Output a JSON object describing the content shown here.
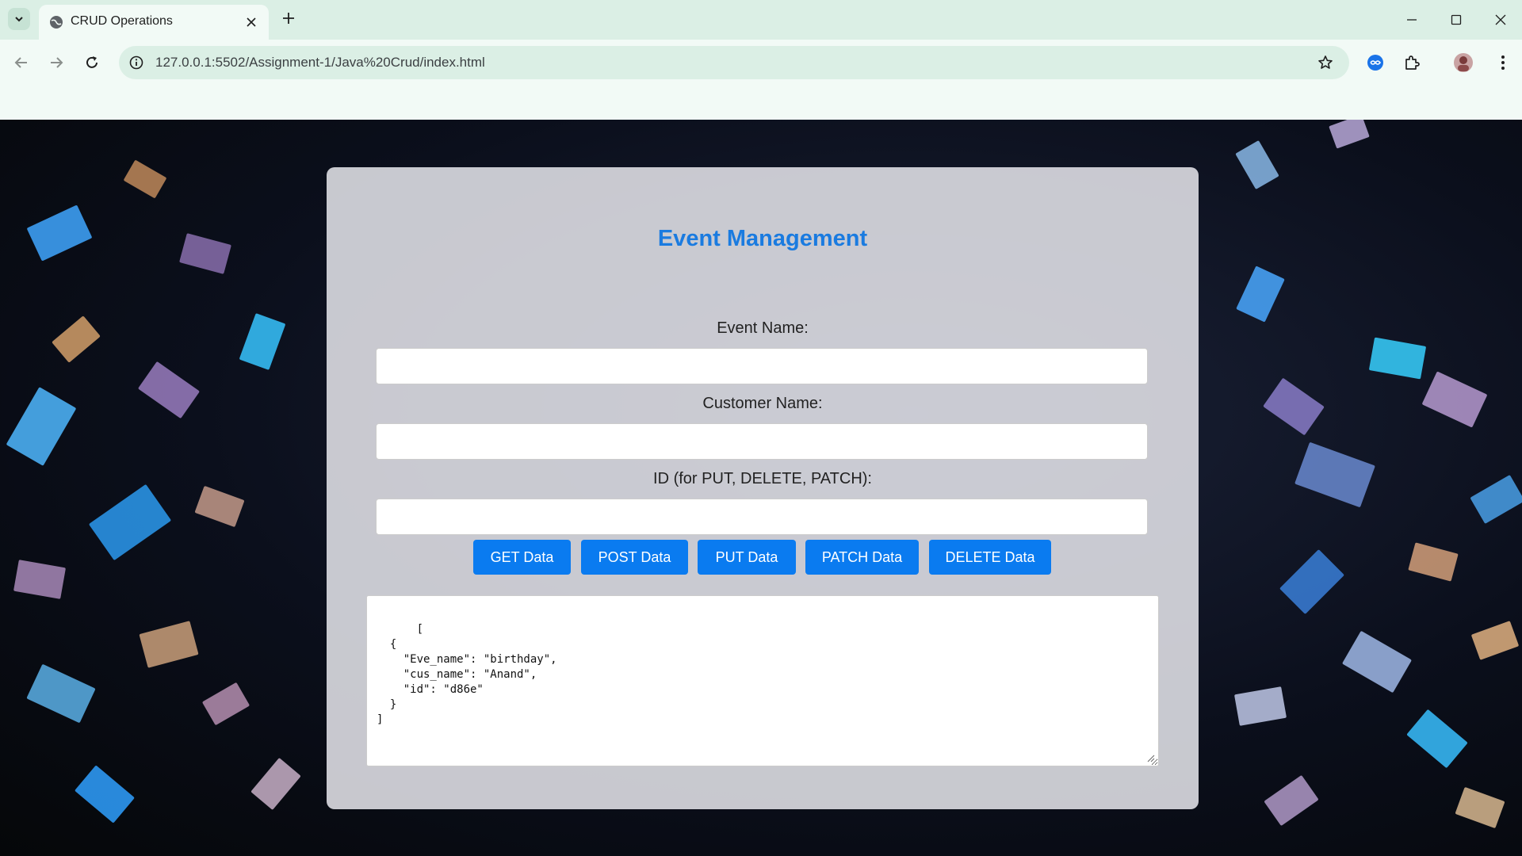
{
  "browser": {
    "tab_title": "CRUD Operations",
    "url": "127.0.0.1:5502/Assignment-1/Java%20Crud/index.html",
    "icons": [
      "tab-search-icon",
      "globe-icon",
      "close-icon",
      "plus-icon",
      "minimize-icon",
      "maximize-icon",
      "window-close-icon",
      "back-icon",
      "forward-icon",
      "reload-icon",
      "info-icon",
      "star-icon",
      "extension-icon",
      "puzzle-icon",
      "avatar",
      "kebab-menu-icon"
    ]
  },
  "page": {
    "title": "Event Management",
    "event_name_label": "Event Name:",
    "event_name_value": "",
    "customer_name_label": "Customer Name:",
    "customer_name_value": "",
    "id_label": "ID (for PUT, DELETE, PATCH):",
    "id_value": "",
    "buttons": {
      "get": "GET Data",
      "post": "POST Data",
      "put": "PUT Data",
      "patch": "PATCH Data",
      "delete": "DELETE Data"
    },
    "output": "[\n  {\n    \"Eve_name\": \"birthday\",\n    \"cus_name\": \"Anand\",\n    \"id\": \"d86e\"\n  }\n]"
  },
  "colors": {
    "accent": "#0a7bf0",
    "title": "#1a7be0",
    "chrome": "#dbefe5",
    "toolbar": "#f2faf6"
  }
}
